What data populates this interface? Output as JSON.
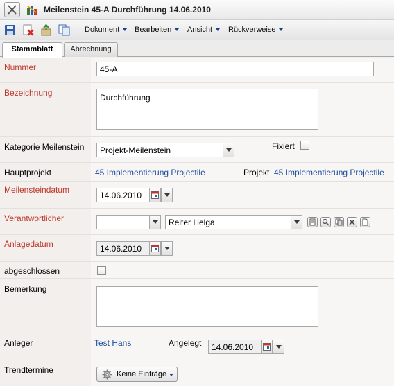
{
  "window": {
    "title": "Meilenstein 45-A Durchführung 14.06.2010"
  },
  "toolbar": {
    "icons": [
      "save-icon",
      "delete-icon",
      "export-icon",
      "copy-icon"
    ],
    "menus": [
      "Dokument",
      "Bearbeiten",
      "Ansicht",
      "Rückverweise"
    ]
  },
  "tabs": [
    {
      "label": "Stammblatt",
      "active": true
    },
    {
      "label": "Abrechnung",
      "active": false
    }
  ],
  "form": {
    "nummer": {
      "label": "Nummer",
      "value": "45-A"
    },
    "bezeichnung": {
      "label": "Bezeichnung",
      "value": "Durchführung"
    },
    "kategorie": {
      "label": "Kategorie Meilenstein",
      "value": "Projekt-Meilenstein"
    },
    "fixiert": {
      "label": "Fixiert",
      "checked": false
    },
    "hauptprojekt": {
      "label": "Hauptprojekt",
      "value": "45 Implementierung Projectile"
    },
    "projekt": {
      "label": "Projekt",
      "value": "45 Implementierung Projectile"
    },
    "meilensteindatum": {
      "label": "Meilensteindatum",
      "value": "14.06.2010"
    },
    "verantwortlicher": {
      "label": "Verantwortlicher",
      "short_value": "",
      "value": "Reiter Helga"
    },
    "anlagedatum": {
      "label": "Anlagedatum",
      "value": "14.06.2010"
    },
    "abgeschlossen": {
      "label": "abgeschlossen",
      "checked": false
    },
    "bemerkung": {
      "label": "Bemerkung",
      "value": ""
    },
    "anleger": {
      "label": "Anleger",
      "value": "Test Hans"
    },
    "angelegt": {
      "label": "Angelegt",
      "value": "14.06.2010"
    },
    "trendtermine": {
      "label": "Trendtermine",
      "button": "Keine Einträge"
    }
  },
  "colors": {
    "required_label": "#c0392b",
    "link": "#1c4ca0",
    "label_background": "#f2efed"
  }
}
